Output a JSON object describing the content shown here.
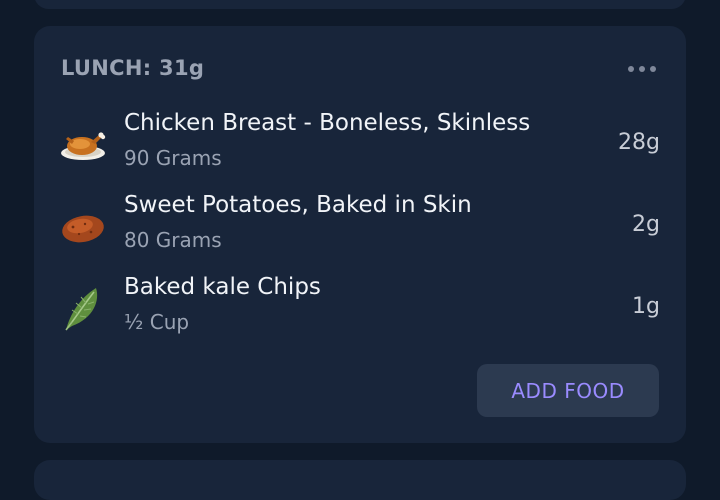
{
  "meal": {
    "title": "LUNCH: 31g",
    "more_icon": "more-horizontal-icon",
    "foods": [
      {
        "name": "Chicken Breast - Boneless, Skinless",
        "amount": "90 Grams",
        "grams": "28g",
        "icon": "roast-chicken-icon"
      },
      {
        "name": "Sweet Potatoes, Baked in Skin",
        "amount": "80 Grams",
        "grams": "2g",
        "icon": "sweet-potato-icon"
      },
      {
        "name": "Baked kale Chips",
        "amount": "½ Cup",
        "grams": "1g",
        "icon": "kale-leaf-icon"
      }
    ],
    "add_food_label": "ADD FOOD"
  },
  "colors": {
    "background": "#0f1a2a",
    "card": "#18253a",
    "accent": "#9a8bff",
    "button_bg": "#2c3a50"
  }
}
